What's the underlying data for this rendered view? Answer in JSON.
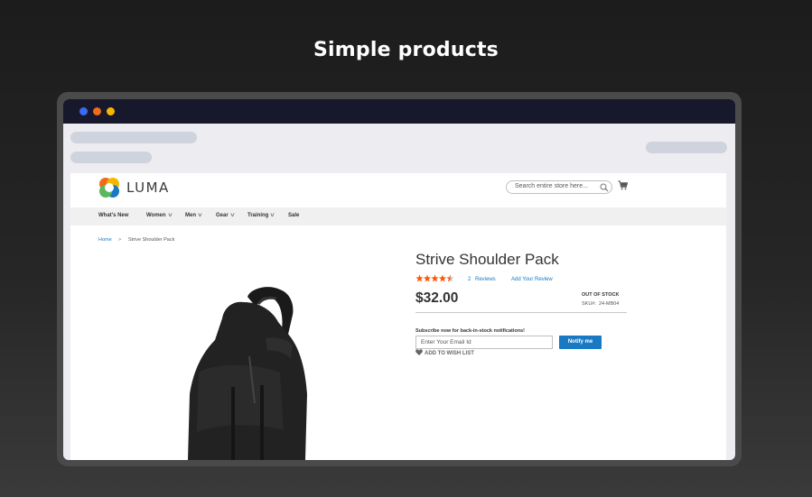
{
  "heading": "Simple products",
  "colors": {
    "dot_blue": "#3b6bf5",
    "dot_orange": "#f26a1b",
    "dot_yellow": "#f5b700",
    "primary_button": "#1979c3",
    "link": "#1979c3",
    "star": "#ff5501"
  },
  "store": {
    "logo_text": "LUMA",
    "search_placeholder": "Search entire store here...",
    "nav": [
      "What's New",
      "Women",
      "Men",
      "Gear",
      "Training",
      "Sale"
    ],
    "breadcrumb": {
      "home": "Home",
      "separator": ">",
      "current": "Strive Shoulder Pack"
    }
  },
  "product": {
    "name": "Strive Shoulder Pack",
    "rating": 4.5,
    "rating_max": 5,
    "reviews_count": "2",
    "reviews_label": "Reviews",
    "add_review": "Add Your Review",
    "price": "$32.00",
    "stock_status": "OUT OF STOCK",
    "sku_label": "SKU#:",
    "sku_value": "24-MB04",
    "subscribe_label": "Subscribe now for back-in-stock notifications!",
    "email_placeholder": "Enter Your Email Id",
    "notify_button": "Notify me",
    "wishlist": "ADD TO WISH LIST"
  }
}
